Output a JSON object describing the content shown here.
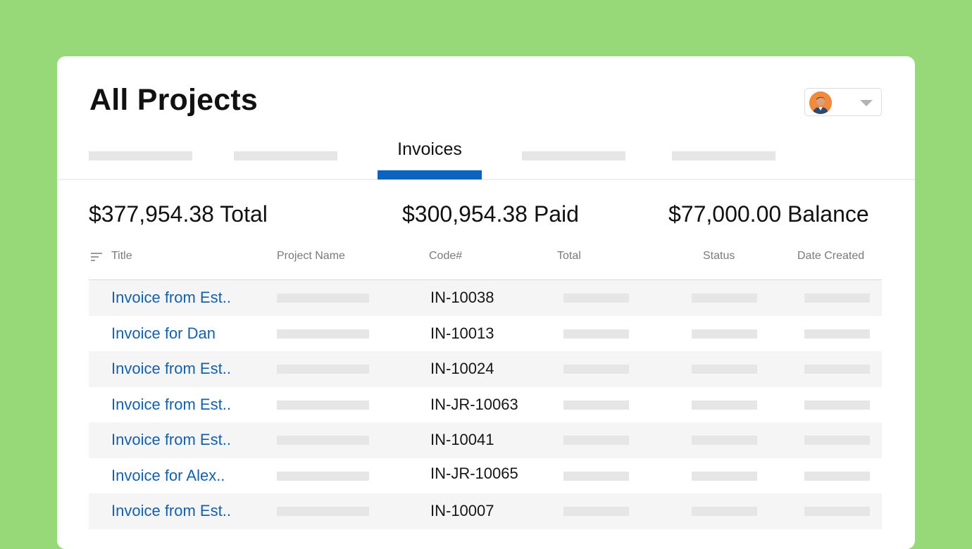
{
  "page": {
    "title": "All Projects"
  },
  "user_menu": {
    "avatar_icon": "user-avatar-icon",
    "dropdown_icon": "chevron-down-icon"
  },
  "tabs": {
    "active_label": "Invoices",
    "accent_color": "#0b63c1"
  },
  "summary": {
    "total": "$377,954.38 Total",
    "paid": "$300,954.38 Paid",
    "balance": "$77,000.00 Balance"
  },
  "table": {
    "sort_icon": "sort-icon",
    "columns": [
      "Title",
      "Project Name",
      "Code#",
      "Total",
      "Status",
      "Date Created"
    ],
    "rows": [
      {
        "title": "Invoice from Est..",
        "code": "IN-10038"
      },
      {
        "title": "Invoice for Dan",
        "code": "IN-10013"
      },
      {
        "title": "Invoice from Est..",
        "code": "IN-10024"
      },
      {
        "title": "Invoice from Est..",
        "code": "IN-JR-10063"
      },
      {
        "title": "Invoice from Est..",
        "code": "IN-10041"
      },
      {
        "title": "Invoice for Alex..",
        "code": "IN-JR-10065"
      },
      {
        "title": "Invoice from Est..",
        "code": "IN-10007"
      }
    ]
  },
  "colors": {
    "background": "#97d978",
    "link": "#1560a9",
    "stripe": "#f5f5f5"
  }
}
